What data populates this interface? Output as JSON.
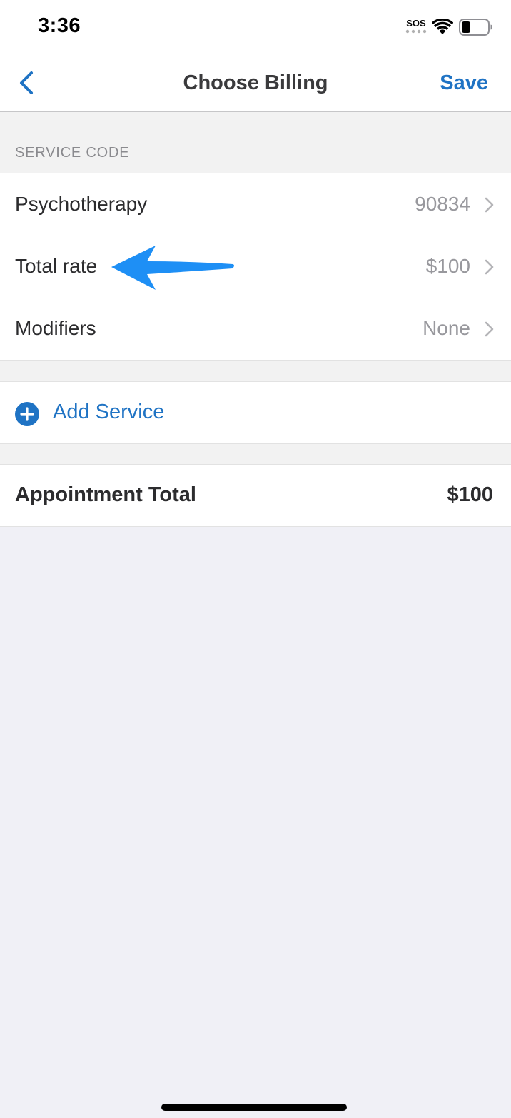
{
  "status_bar": {
    "time": "3:36",
    "sos_label": "SOS",
    "wifi_icon": "wifi-icon",
    "battery_icon": "battery-icon",
    "battery_level": 0.35
  },
  "nav": {
    "back_icon": "chevron-left-icon",
    "title": "Choose Billing",
    "save_label": "Save"
  },
  "service_section": {
    "header": "SERVICE CODE",
    "rows": [
      {
        "label": "Psychotherapy",
        "value": "90834"
      },
      {
        "label": "Total rate",
        "value": "$100"
      },
      {
        "label": "Modifiers",
        "value": "None"
      }
    ]
  },
  "add_service": {
    "icon": "plus-circle-icon",
    "label": "Add Service"
  },
  "appointment_total": {
    "label": "Appointment Total",
    "value": "$100"
  },
  "annotation": {
    "icon": "arrow-left-icon",
    "color": "#1e8ff5"
  },
  "colors": {
    "accent": "#1f73c4",
    "background": "#f0f0f6",
    "section_background": "#f2f2f2"
  }
}
